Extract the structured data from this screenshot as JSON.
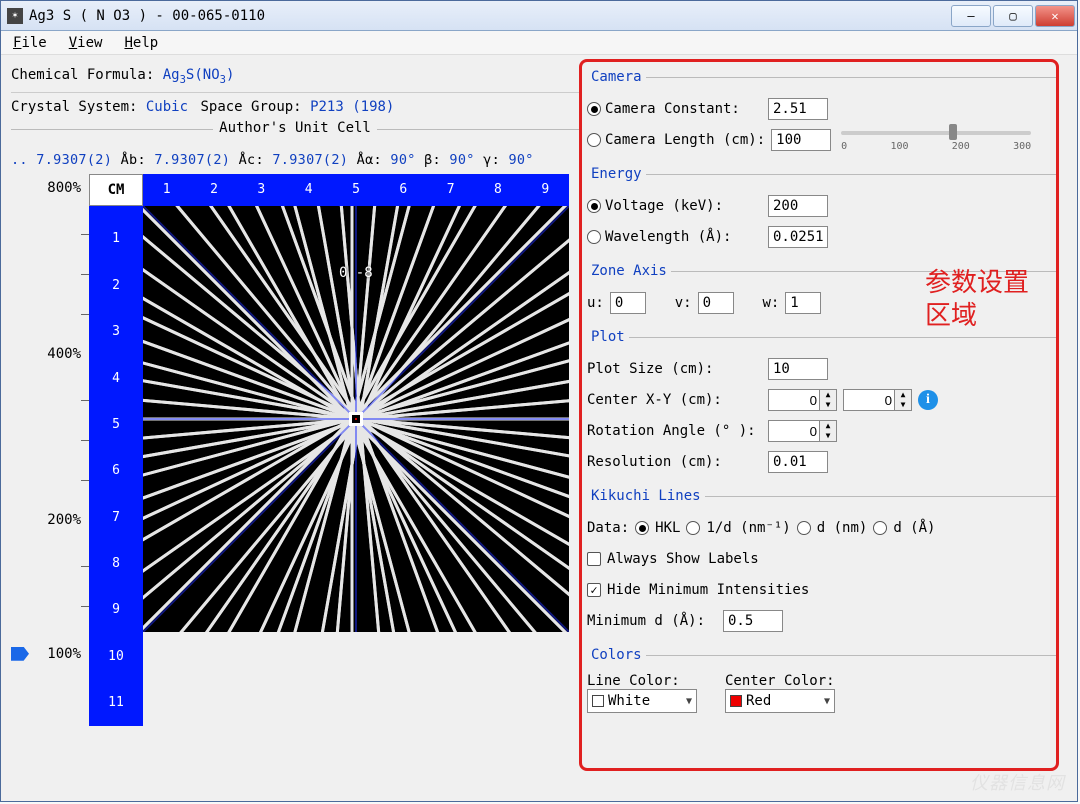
{
  "window": {
    "title": "Ag3 S ( N O3 ) - 00-065-0110",
    "menu": {
      "file": "File",
      "view": "View",
      "help": "Help"
    }
  },
  "info": {
    "chem_label": "Chemical Formula:",
    "chem_value_html": "Ag₃S(NO₃)",
    "crystal_label": "Crystal System:",
    "crystal_value": "Cubic",
    "spacegroup_label": "Space Group:",
    "spacegroup_value": "P213 (198)",
    "unitcell_legend": "Author's Unit Cell",
    "unitcell_prefix": "..",
    "a": "7.9307(2)",
    "b": "7.9307(2)",
    "c": "7.9307(2)",
    "alpha": "90°",
    "beta": "90°",
    "gamma": "90°"
  },
  "yscale": {
    "800": "800%",
    "400": "400%",
    "200": "200%",
    "100": "100%"
  },
  "plot": {
    "cm_label": "CM",
    "ruler_top": [
      "1",
      "2",
      "3",
      "4",
      "5",
      "6",
      "7",
      "8",
      "9"
    ],
    "ruler_left": [
      "1",
      "2",
      "3",
      "4",
      "5",
      "6",
      "7",
      "8",
      "9",
      "10",
      "11"
    ],
    "center_overlay": "0 -8"
  },
  "camera": {
    "legend": "Camera",
    "constant_label": "Camera Constant:",
    "constant_value": "2.51",
    "length_label": "Camera Length (cm):",
    "length_value": "100",
    "selected": "constant",
    "slider": {
      "ticks": [
        "0",
        "100",
        "200",
        "300"
      ]
    }
  },
  "energy": {
    "legend": "Energy",
    "voltage_label": "Voltage (keV):",
    "voltage_value": "200",
    "wavelength_label": "Wavelength (Å):",
    "wavelength_value": "0.0251",
    "selected": "voltage"
  },
  "zone": {
    "legend": "Zone Axis",
    "u_label": "u:",
    "u": "0",
    "v_label": "v:",
    "v": "0",
    "w_label": "w:",
    "w": "1"
  },
  "plotset": {
    "legend": "Plot",
    "size_label": "Plot Size (cm):",
    "size": "10",
    "center_label": "Center X-Y (cm):",
    "cx": "0",
    "cy": "0",
    "rot_label": "Rotation Angle (° ):",
    "rot": "0",
    "res_label": "Resolution (cm):",
    "res": "0.01"
  },
  "kikuchi": {
    "legend": "Kikuchi Lines",
    "data_label": "Data:",
    "opts": {
      "hkl": "HKL",
      "invd": "1/d (nm⁻¹)",
      "dnm": "d (nm)",
      "dA": "d (Å)"
    },
    "selected_data": "hkl",
    "always_show": false,
    "always_show_label": "Always Show Labels",
    "hide_min": true,
    "hide_min_label": "Hide Minimum Intensities",
    "mind_label": "Minimum d (Å):",
    "mind": "0.5"
  },
  "colors": {
    "legend": "Colors",
    "line_label": "Line Color:",
    "line": "White",
    "center_label": "Center Color:",
    "center": "Red"
  },
  "annotation": {
    "l1": "参数设置",
    "l2": "区域"
  },
  "watermark": "仪器信息网"
}
